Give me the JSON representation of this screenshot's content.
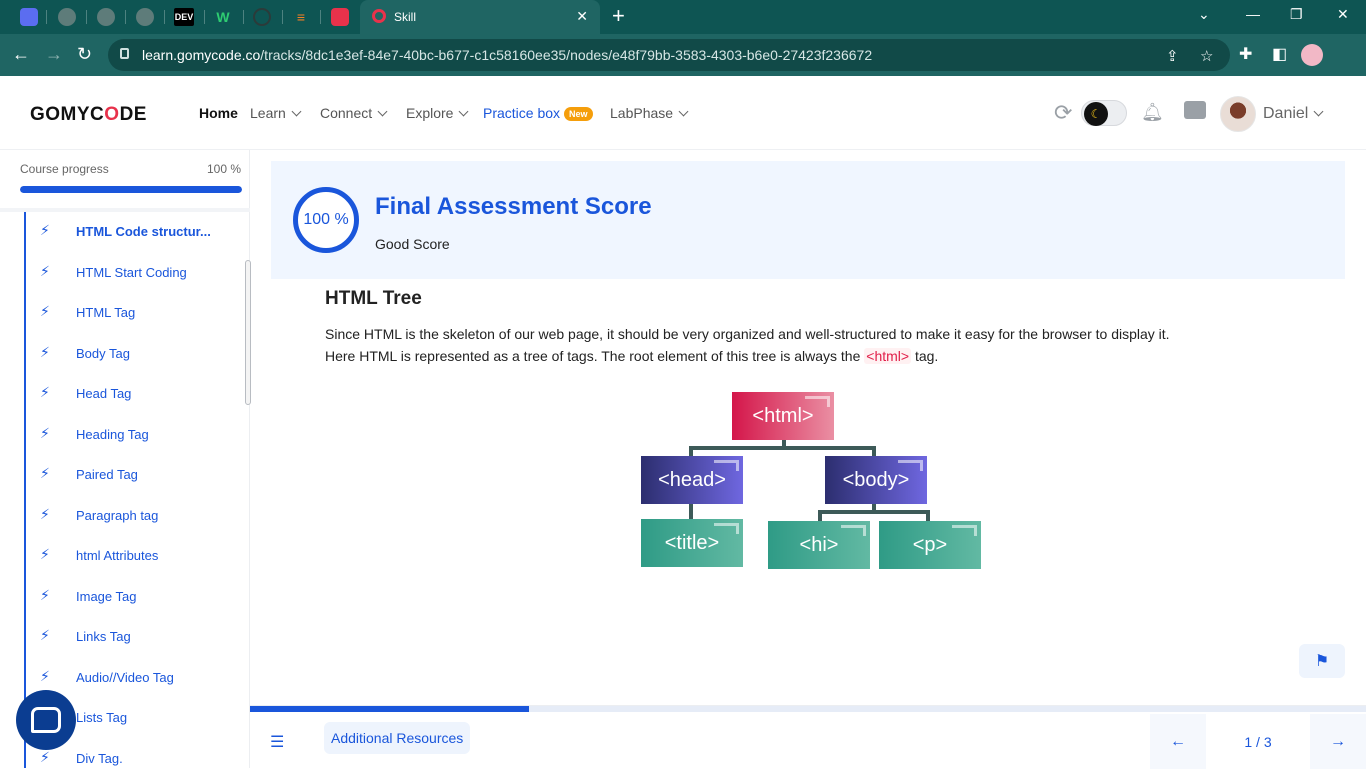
{
  "browser": {
    "tab_title": "Skill",
    "tab_close": "✕",
    "new_tab": "+",
    "url_domain": "learn.gomycode.co",
    "url_path": "/tracks/8dc1e3ef-84e7-40bc-b677-c1c58160ee35/nodes/e48f79bb-3583-4303-b6e0-27423f236672",
    "favicons": [
      "app",
      "globe",
      "globe",
      "globe",
      "DEV",
      "W",
      "gh",
      "so",
      "ext"
    ],
    "accent_color": "#0e5553"
  },
  "header": {
    "logo": "GOMYCODE",
    "nav": {
      "home": "Home",
      "learn": "Learn",
      "connect": "Connect",
      "explore": "Explore",
      "practice_box": "Practice box",
      "practice_badge": "New",
      "labphase": "LabPhase"
    },
    "username": "Daniel",
    "theme_mode": "dark"
  },
  "sidebar": {
    "progress_label": "Course progress",
    "progress_value": "100 %",
    "progress_fraction": 1.0,
    "lessons": [
      {
        "label": "HTML Code structur...",
        "current": true
      },
      {
        "label": "HTML Start Coding"
      },
      {
        "label": "HTML Tag"
      },
      {
        "label": "Body Tag"
      },
      {
        "label": "Head Tag"
      },
      {
        "label": "Heading Tag"
      },
      {
        "label": "Paired Tag"
      },
      {
        "label": "Paragraph tag"
      },
      {
        "label": "html Attributes"
      },
      {
        "label": "Image Tag"
      },
      {
        "label": "Links Tag"
      },
      {
        "label": "Audio//Video Tag"
      },
      {
        "label": "Lists Tag"
      },
      {
        "label": "Div Tag."
      }
    ]
  },
  "main": {
    "score_value": "100 %",
    "score_title": "Final Assessment Score",
    "score_subtitle": "Good Score",
    "section_title": "HTML Tree",
    "para_1": "Since HTML is the skeleton of our web page, it should be very organized and well-structured to make it easy for the browser to display it.",
    "para_2_start": "Here HTML is represented as a tree of tags. The root element of this tree is always the ",
    "para_2_code": "<html>",
    "para_2_end": " tag.",
    "tree": {
      "root": "<html>",
      "head": "<head>",
      "body": "<body>",
      "title": "<title>",
      "hi": "<hi>",
      "p": "<p>"
    }
  },
  "bottom": {
    "additional_resources": "Additional Resources",
    "page_indicator": "1 / 3",
    "slide_progress_fraction": 0.25
  },
  "colors": {
    "primary": "#1a56db",
    "brand_red": "#e8324b"
  }
}
